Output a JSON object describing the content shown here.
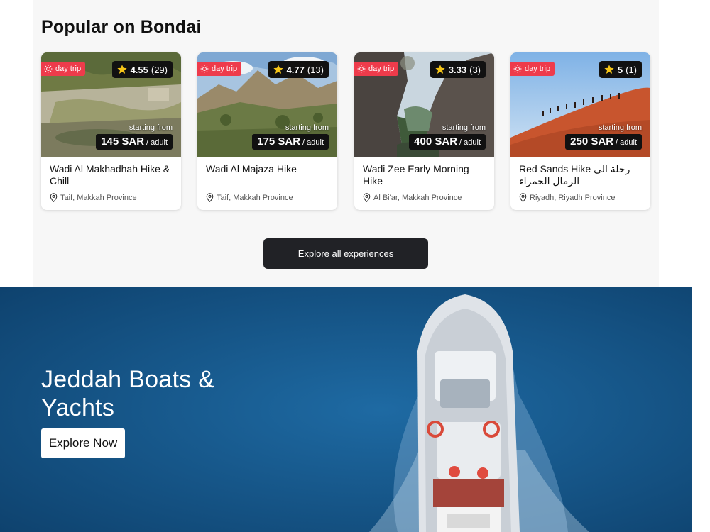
{
  "popular": {
    "heading": "Popular on Bondai",
    "cards": [
      {
        "tag": "day trip",
        "rating": "4.55",
        "reviews": "(29)",
        "from_label": "starting from",
        "price": "145 SAR",
        "unit": "/ adult",
        "title": "Wadi Al Makhadhah Hike & Chill",
        "location": "Taif, Makkah Province"
      },
      {
        "tag": "day trip",
        "rating": "4.77",
        "reviews": "(13)",
        "from_label": "starting from",
        "price": "175 SAR",
        "unit": "/ adult",
        "title": "Wadi Al Majaza Hike",
        "location": "Taif, Makkah Province"
      },
      {
        "tag": "day trip",
        "rating": "3.33",
        "reviews": "(3)",
        "from_label": "starting from",
        "price": "400 SAR",
        "unit": "/ adult",
        "title": "Wadi Zee Early Morning Hike",
        "location": "Al Bi'ar, Makkah Province"
      },
      {
        "tag": "day trip",
        "rating": "5",
        "reviews": "(1)",
        "from_label": "starting from",
        "price": "250 SAR",
        "unit": "/ adult",
        "title": "Red Sands Hike رحلة الى الرمال الحمراء",
        "location": "Riyadh, Riyadh Province"
      }
    ],
    "explore_label": "Explore all experiences"
  },
  "hero": {
    "title": "Jeddah Boats & Yachts",
    "cta_label": "Explore Now"
  },
  "colors": {
    "tag": "#ee3b4b",
    "star": "#f5c518",
    "button_dark": "#212226",
    "sea": "#0e4d7e"
  },
  "icons": {
    "tag": "sun-icon",
    "rating": "star-icon",
    "location": "map-pin-icon"
  }
}
